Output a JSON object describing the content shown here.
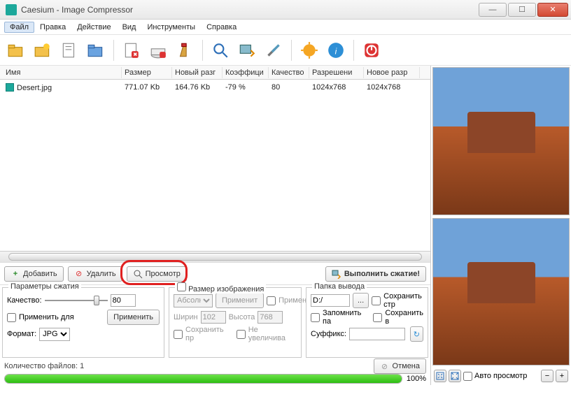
{
  "window": {
    "title": "Caesium - Image Compressor"
  },
  "menu": {
    "file": "Файл",
    "edit": "Правка",
    "action": "Действие",
    "view": "Вид",
    "tools": "Инструменты",
    "help": "Справка"
  },
  "table": {
    "head": {
      "name": "Имя",
      "size": "Размер",
      "newsize": "Новый разг",
      "ratio": "Коэффици",
      "quality": "Качество",
      "res": "Разрешени",
      "newres": "Новое разр"
    },
    "rows": [
      {
        "name": "Desert.jpg",
        "size": "771.07 Kb",
        "newsize": "164.76 Kb",
        "ratio": "-79 %",
        "quality": "80",
        "res": "1024x768",
        "newres": "1024x768"
      }
    ]
  },
  "actions": {
    "add": "Добавить",
    "remove": "Удалить",
    "preview": "Просмотр",
    "compress": "Выполнить сжатие!"
  },
  "compress": {
    "title": "Параметры сжатия",
    "quality_label": "Качество:",
    "quality_value": "80",
    "apply_all": "Применить для",
    "apply": "Применить",
    "format_label": "Формат:",
    "format_value": "JPG"
  },
  "resize": {
    "title": "Размер изображения",
    "abs": "Абсолн",
    "apply_btn": "Применит",
    "apply_chk": "Примен",
    "width_label": "Ширин",
    "width_value": "102",
    "height_label": "Высота",
    "height_value": "768",
    "keep": "Сохранить пр",
    "noenlarge": "Не увеличива"
  },
  "output": {
    "title": "Папка вывода",
    "path": "D:/",
    "browse": "...",
    "keep_struct": "Сохранить стр",
    "remember": "Запомнить па",
    "save_in": "Сохранить в",
    "suffix_label": "Суффикс:",
    "suffix_value": ""
  },
  "status": {
    "count_label": "Количество файлов:",
    "count": "1",
    "cancel": "Отмена",
    "progress_pct": "100%",
    "progress_fill": 100
  },
  "preview_ctrl": {
    "auto": "Авто просмотр"
  }
}
